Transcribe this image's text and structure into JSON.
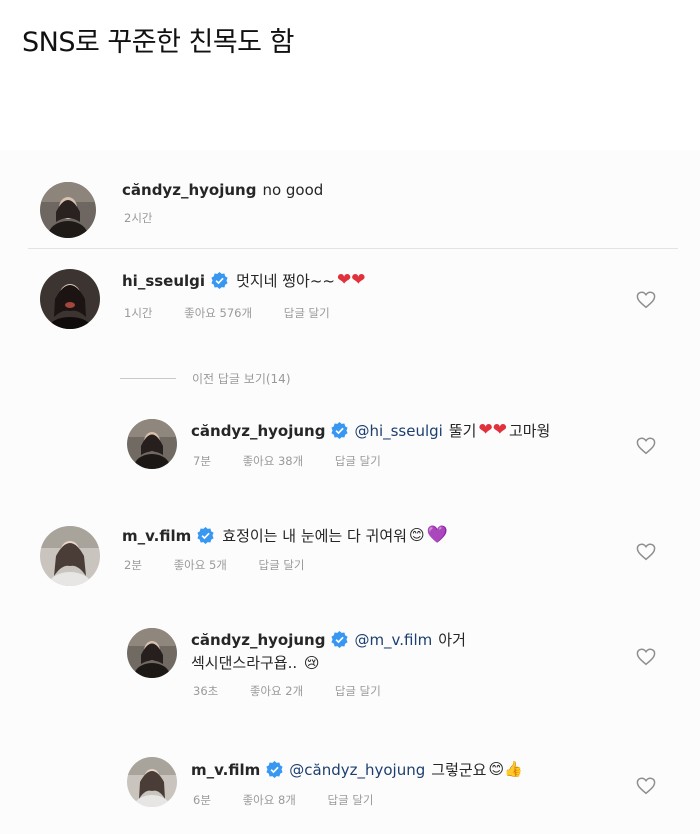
{
  "post": {
    "title": "SNS로 꾸준한 친목도 함"
  },
  "view_replies": "이전 답글 보기(14)",
  "comments": [
    {
      "username": "căndyz_hyojung",
      "text": "no good",
      "time": "2시간",
      "verified": false
    },
    {
      "username": "hi_sseulgi",
      "text": "멋지네 쩡아~~",
      "emoji": "❤❤",
      "time": "1시간",
      "likes": "좋아요 576개",
      "reply": "답글 달기",
      "verified": true
    },
    {
      "username": "căndyz_hyojung",
      "mention": "@hi_sseulgi",
      "text": "뚤기",
      "emoji": "❤❤",
      "text_after": "고마웡",
      "time": "7분",
      "likes": "좋아요 38개",
      "reply": "답글 달기",
      "verified": true
    },
    {
      "username": "m_v.film",
      "text": "효정이는 내 눈에는 다 귀여워",
      "emoji": "😊",
      "emoji2": "💜",
      "time": "2분",
      "likes": "좋아요 5개",
      "reply": "답글 달기",
      "verified": true
    },
    {
      "username": "căndyz_hyojung",
      "mention": "@m_v.film",
      "text": "아거",
      "text_line2": "섹시댄스라구욥..",
      "emoji": "😢",
      "time": "36초",
      "likes": "좋아요 2개",
      "reply": "답글 달기",
      "verified": true
    },
    {
      "username": "m_v.film",
      "mention": "@căndyz_hyojung",
      "text": "그렇군요",
      "emoji": "😊👍",
      "time": "6분",
      "likes": "좋아요 8개",
      "reply": "답글 달기",
      "verified": true
    }
  ],
  "colors": {
    "verified_badge": "#3897f0",
    "heart_emoji": "#e0313c",
    "purple_heart": "#8c4fd6",
    "meta_text": "#9a9a9a"
  },
  "icons": [
    "verified-badge-icon",
    "heart-outline-icon"
  ]
}
